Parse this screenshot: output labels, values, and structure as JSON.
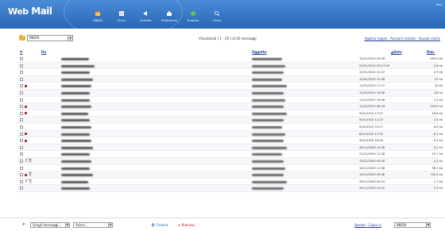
{
  "app": {
    "logo_part1": "Web",
    "logo_part2": "Mail",
    "topright": "Esci"
  },
  "nav": [
    {
      "label": "INBOX",
      "icon": "inbox-icon"
    },
    {
      "label": "Scrivi",
      "icon": "compose-icon"
    },
    {
      "label": "Cartelle",
      "icon": "folders-icon"
    },
    {
      "label": "Preferenze",
      "icon": "preferences-icon"
    },
    {
      "label": "Rubrica",
      "icon": "addressbook-icon"
    },
    {
      "label": "Cerca",
      "icon": "search-icon"
    }
  ],
  "toolbar": {
    "folder": "INBOX",
    "view_info": "Visualizzati [ 1 - 20 ] di 20 messaggi",
    "links": [
      "Applica regole",
      "Account remoto",
      "Svuota cache"
    ]
  },
  "columns": {
    "num": "#",
    "from": "Da",
    "subject": "Oggetto",
    "date": "▲Data",
    "size": "Dim."
  },
  "rows": [
    {
      "date": "15/01/2010 09:28",
      "size": "269.5 kb",
      "flag": false,
      "excl": false,
      "clip": false,
      "fw": 35,
      "sw": 38
    },
    {
      "date": "22/01/2010 03:17:00",
      "size": "2.8 kb",
      "flag": false,
      "excl": false,
      "clip": false,
      "fw": 42,
      "sw": 42
    },
    {
      "date": "12/01/2010 10:47",
      "size": "4.9 kb",
      "flag": false,
      "excl": false,
      "clip": false,
      "fw": 36,
      "sw": 40
    },
    {
      "date": "12/01/2010 11:58",
      "size": "12 kb",
      "flag": false,
      "excl": false,
      "clip": false,
      "fw": 40,
      "sw": 38
    },
    {
      "date": "11/01/2010 17:27",
      "size": "44 kb",
      "flag": true,
      "excl": false,
      "clip": false,
      "fw": 38,
      "sw": 44
    },
    {
      "date": "11/01/2010 16:48",
      "size": "43 kb",
      "flag": false,
      "excl": false,
      "clip": false,
      "fw": 36,
      "sw": 40
    },
    {
      "date": "11/01/2010 16:08",
      "size": "1.5 kb",
      "flag": false,
      "excl": false,
      "clip": false,
      "fw": 36,
      "sw": 42
    },
    {
      "date": "11/01/2010 08:43",
      "size": "244.5 kb",
      "flag": true,
      "excl": false,
      "clip": false,
      "fw": 38,
      "sw": 40
    },
    {
      "date": "9/01/2010 17:47",
      "size": "18.8 kb",
      "flag": true,
      "excl": false,
      "clip": false,
      "fw": 34,
      "sw": 44
    },
    {
      "date": "9/01/2010 11:23",
      "size": "3.4 kb",
      "flag": false,
      "excl": false,
      "clip": false,
      "fw": 36,
      "sw": 40
    },
    {
      "date": "9/01/2010 10:17",
      "size": "8.9 kb",
      "flag": false,
      "excl": false,
      "clip": false,
      "fw": 38,
      "sw": 38
    },
    {
      "date": "8/01/2010 13:35",
      "size": "8.7 kb",
      "flag": true,
      "excl": false,
      "clip": false,
      "fw": 36,
      "sw": 42
    },
    {
      "date": "4/01/2010 16:58",
      "size": "3.4 kb",
      "flag": true,
      "excl": false,
      "clip": false,
      "fw": 38,
      "sw": 40
    },
    {
      "date": "30/12/2009 12:28",
      "size": "3.1 kb",
      "flag": false,
      "excl": false,
      "clip": false,
      "fw": 40,
      "sw": 44
    },
    {
      "date": "22/12/2009 11:38",
      "size": "29.7 kb",
      "flag": false,
      "excl": false,
      "clip": false,
      "fw": 36,
      "sw": 38
    },
    {
      "date": "15/12/2009 09:28",
      "size": "2.2 kb",
      "flag": false,
      "excl": true,
      "clip": true,
      "fw": 38,
      "sw": 40
    },
    {
      "date": "14/12/2009 11:08",
      "size": "98.7 kb",
      "flag": false,
      "excl": false,
      "clip": false,
      "fw": 36,
      "sw": 42
    },
    {
      "date": "10/12/2009 09:48",
      "size": "732.4 kb",
      "flag": true,
      "excl": false,
      "clip": true,
      "fw": 40,
      "sw": 40
    },
    {
      "date": "28/11/2009 09:34",
      "size": "1.2 kb",
      "flag": false,
      "excl": true,
      "clip": true,
      "fw": 34,
      "sw": 44
    },
    {
      "date": "30/11/2009 14:32",
      "size": "2.9 kb",
      "flag": false,
      "excl": false,
      "clip": false,
      "fw": 36,
      "sw": 40
    }
  ],
  "bottom": {
    "sep": "#",
    "select_msgs": "Scegli messaggi...",
    "action": "Azioni...",
    "cestina": "Cestina",
    "rimuovi": "Rimuovi",
    "sposta": "Sposta - Copia in",
    "target": "INBOX"
  },
  "colors": {
    "header": "#2767b7",
    "link": "#1a3d8f",
    "delete": "#cc0000"
  }
}
